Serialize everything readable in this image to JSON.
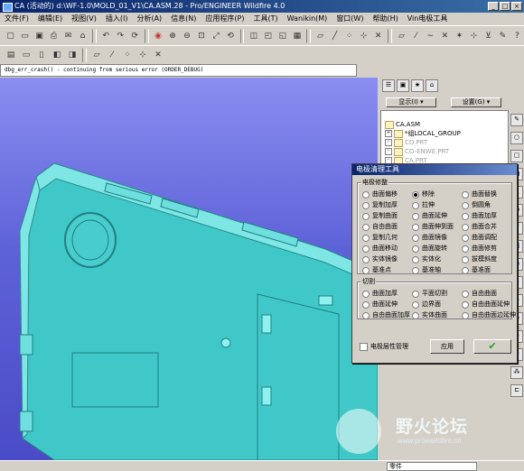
{
  "window": {
    "title": "CA (活动的) d:\\WF-1.0\\MOLD_01_V1\\CA.ASM.28 - Pro/ENGINEER Wildfire 4.0",
    "min": "_",
    "max": "□",
    "close": "×"
  },
  "menu": [
    "文件(F)",
    "编辑(E)",
    "视图(V)",
    "插入(I)",
    "分析(A)",
    "信息(N)",
    "应用程序(P)",
    "工具(T)",
    "Wanikin(M)",
    "窗口(W)",
    "帮助(H)",
    "Vin电极工具"
  ],
  "message": "dbg_err_crash() - continuing from serious error (ORDER_DEBUG)",
  "panel": {
    "show_label": "显示(I) ▾",
    "settings_label": "设置(G) ▾",
    "tree": [
      {
        "label": "CA.ASM",
        "dim": false
      },
      {
        "label": "*组LOCAL_GROUP",
        "dim": false
      },
      {
        "label": "CO.PRT",
        "dim": true
      },
      {
        "label": "CO-ENWE.PRT",
        "dim": true
      },
      {
        "label": "CA.PRT",
        "dim": true
      }
    ]
  },
  "dialog": {
    "title": "电极清理工具",
    "group1_title": "电极修整",
    "options1": [
      [
        "曲面偏移",
        "移除",
        "曲面替换"
      ],
      [
        "复制加厚",
        "拉伸",
        "倒圆角"
      ],
      [
        "复制曲面",
        "曲面延伸",
        "曲面加厚"
      ],
      [
        "自由曲面",
        "曲面伸到面",
        "曲面合并"
      ],
      [
        "复制几何",
        "曲面镜像",
        "曲面调配"
      ],
      [
        "曲面移动",
        "曲面旋转",
        "曲面修剪"
      ],
      [
        "实体镜像",
        "实体化",
        "拔模斜度"
      ],
      [
        "基准点",
        "基准轴",
        "基准面"
      ]
    ],
    "selected1": "移除",
    "group2_title": "切割",
    "options2": [
      [
        "曲面加厚",
        "平面切割",
        "自由曲面"
      ],
      [
        "曲面延伸",
        "边界面",
        "自由曲面延伸"
      ],
      [
        "自由曲面加厚",
        "实体曲面",
        "自由曲面边延伸"
      ]
    ],
    "checkbox_label": "电极层性管理",
    "apply_label": "应用",
    "ok_symbol": "✔"
  },
  "watermark": {
    "text": "野火论坛",
    "url": "www.proewildfire.cn"
  },
  "status": {
    "filter": "零件"
  }
}
